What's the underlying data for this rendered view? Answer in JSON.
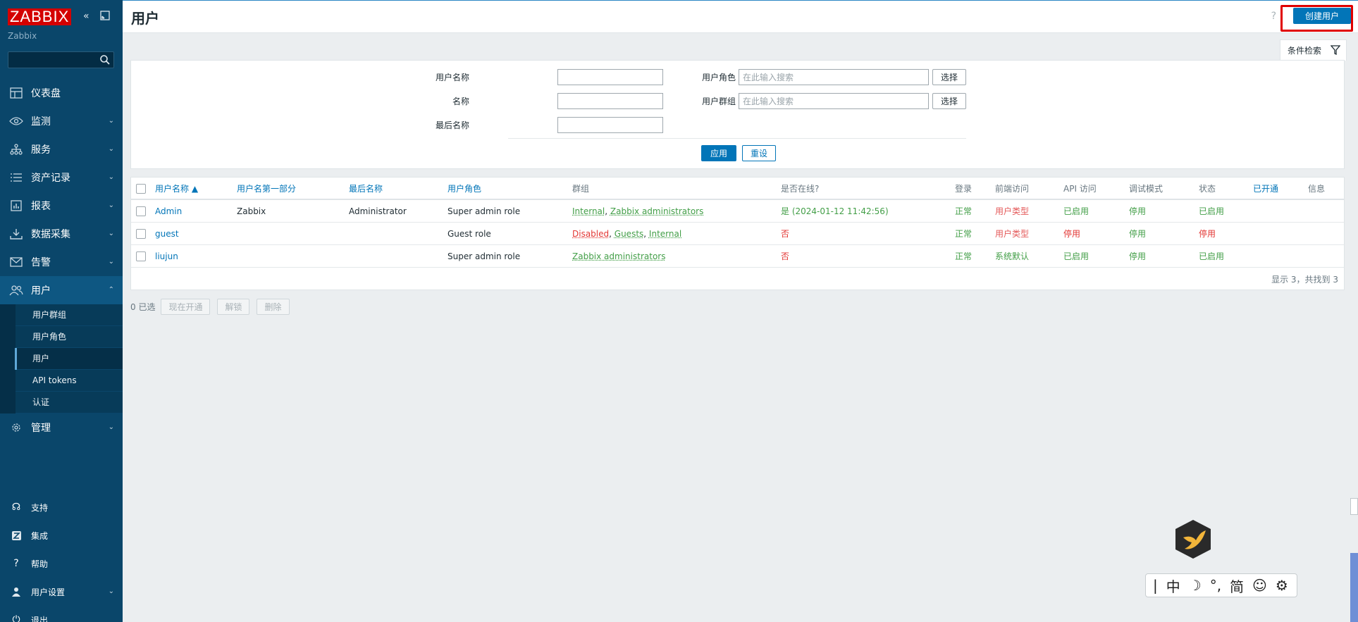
{
  "app": {
    "logo_text": "ZABBIX",
    "server_name": "Zabbix",
    "collapse_icon": "double-chevron-left-icon",
    "kiosk_icon": "kiosk-mode-icon"
  },
  "sidebar": {
    "search_placeholder": "",
    "items": [
      {
        "label": "仪表盘",
        "icon": "dashboard-icon"
      },
      {
        "label": "监测",
        "icon": "eye-icon"
      },
      {
        "label": "服务",
        "icon": "services-icon"
      },
      {
        "label": "资产记录",
        "icon": "list-icon"
      },
      {
        "label": "报表",
        "icon": "report-icon"
      },
      {
        "label": "数据采集",
        "icon": "download-icon"
      },
      {
        "label": "告警",
        "icon": "envelope-icon"
      },
      {
        "label": "用户",
        "icon": "users-icon"
      },
      {
        "label": "管理",
        "icon": "gear-icon"
      }
    ],
    "submenu": [
      {
        "label": "用户群组"
      },
      {
        "label": "用户角色"
      },
      {
        "label": "用户"
      },
      {
        "label": "API tokens"
      },
      {
        "label": "认证"
      }
    ],
    "bottom": [
      {
        "label": "支持",
        "icon": "headset-icon"
      },
      {
        "label": "集成",
        "icon": "integration-icon"
      },
      {
        "label": "帮助",
        "icon": "help-icon"
      },
      {
        "label": "用户设置",
        "icon": "user-icon"
      },
      {
        "label": "退出",
        "icon": "power-icon"
      }
    ]
  },
  "header": {
    "title": "用户",
    "help_glyph": "?",
    "create_label": "创建用户"
  },
  "filter": {
    "tab_label": "条件检索",
    "username_label": "用户名称",
    "name_label": "名称",
    "lastname_label": "最后名称",
    "role_label": "用户角色",
    "group_label": "用户群组",
    "role_placeholder": "在此输入搜索",
    "group_placeholder": "在此输入搜索",
    "select_label": "选择",
    "apply_label": "应用",
    "reset_label": "重设"
  },
  "table": {
    "columns": {
      "username": "用户名称 ▲",
      "name": "用户名第一部分",
      "surname": "最后名称",
      "role": "用户角色",
      "groups": "群组",
      "online": "是否在线?",
      "login": "登录",
      "frontend": "前端访问",
      "api": "API 访问",
      "debug": "调试模式",
      "status": "状态",
      "provisioned": "已开通",
      "info": "信息"
    },
    "rows": [
      {
        "username": "Admin",
        "name": "Zabbix",
        "surname": "Administrator",
        "role": "Super admin role",
        "group1": "Internal",
        "sep1": ", ",
        "group2": "Zabbix administrators",
        "sep2": "",
        "group3": "",
        "online": "是 (2024-01-12 11:42:56)",
        "login": "正常",
        "frontend": "用户类型",
        "api": "已启用",
        "debug": "停用",
        "status": "已启用"
      },
      {
        "username": "guest",
        "name": "",
        "surname": "",
        "role": "Guest role",
        "group1": "Disabled",
        "sep1": ", ",
        "group2": "Guests",
        "sep2": ", ",
        "group3": "Internal",
        "online": "否",
        "login": "正常",
        "frontend": "用户类型",
        "api": "停用",
        "debug": "停用",
        "status": "停用"
      },
      {
        "username": "liujun",
        "name": "",
        "surname": "",
        "role": "Super admin role",
        "group1": "Zabbix administrators",
        "sep1": "",
        "group2": "",
        "sep2": "",
        "group3": "",
        "online": "否",
        "login": "正常",
        "frontend": "系统默认",
        "api": "已启用",
        "debug": "停用",
        "status": "已启用"
      }
    ],
    "footer": "显示 3，共找到 3"
  },
  "mass_actions": {
    "selected": "0 已选",
    "provision_label": "现在开通",
    "unblock_label": "解锁",
    "delete_label": "删除"
  },
  "ime": {
    "cursor": "|",
    "mode": "中",
    "moon": "☽",
    "punct": "°,",
    "simplified": "简",
    "emoji": "☺",
    "settings": "⚙"
  },
  "colors": {
    "sidebar": "#0a466a",
    "accent": "#0275b8",
    "green": "#429e47",
    "red": "#e33734",
    "highlight": "#e00000"
  }
}
